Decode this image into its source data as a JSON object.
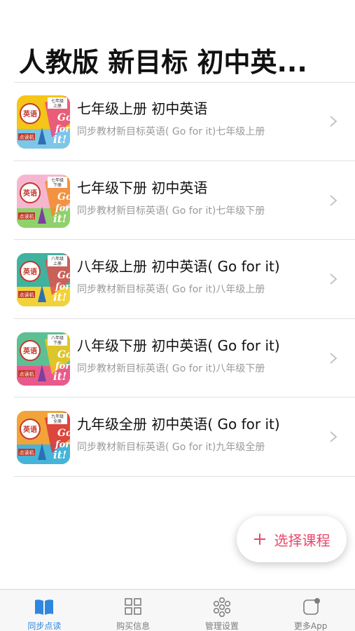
{
  "header": {
    "title": "人教版 新目标 初中英..."
  },
  "courses": [
    {
      "title": "七年级上册 初中英语",
      "subtitle": "同步教材新目标英语( Go for it)七年级上册",
      "cover": {
        "badge": "英语",
        "grade_tag": "七年级\n上册",
        "tag": "点读机",
        "slogan": "Go for it!",
        "bg": "#f5c518"
      }
    },
    {
      "title": "七年级下册 初中英语",
      "subtitle": "同步教材新目标英语( Go for it)七年级下册",
      "cover": {
        "badge": "英语",
        "grade_tag": "七年级\n下册",
        "tag": "点读机",
        "slogan": "Go for it!",
        "bg": "#f4a6c8"
      }
    },
    {
      "title": "八年级上册 初中英语( Go for it)",
      "subtitle": "同步教材新目标英语( Go for it)八年级上册",
      "cover": {
        "badge": "英语",
        "grade_tag": "八年级\n上册",
        "tag": "点读机",
        "slogan": "Go for it!",
        "bg": "#48b89a"
      }
    },
    {
      "title": "八年级下册 初中英语( Go for it)",
      "subtitle": "同步教材新目标英语( Go for it)八年级下册",
      "cover": {
        "badge": "英语",
        "grade_tag": "八年级\n下册",
        "tag": "点读机",
        "slogan": "Go for it!",
        "bg": "#5bbf9a"
      }
    },
    {
      "title": "九年级全册 初中英语( Go for it)",
      "subtitle": "同步教材新目标英语( Go for it)九年级全册",
      "cover": {
        "badge": "英语",
        "grade_tag": "九年级\n全册",
        "tag": "点读机",
        "slogan": "Go for it!",
        "bg": "#f2a33a"
      }
    }
  ],
  "fab": {
    "label": "选择课程",
    "icon": "plus-icon",
    "color": "#e8476b"
  },
  "tabbar": {
    "active_color": "#2f86e0",
    "tabs": [
      {
        "label": "同步点读",
        "icon": "book-icon",
        "active": true
      },
      {
        "label": "购买信息",
        "icon": "grid-icon",
        "active": false
      },
      {
        "label": "管理设置",
        "icon": "settings-dots-icon",
        "active": false
      },
      {
        "label": "更多App",
        "icon": "more-app-icon",
        "active": false
      }
    ]
  }
}
